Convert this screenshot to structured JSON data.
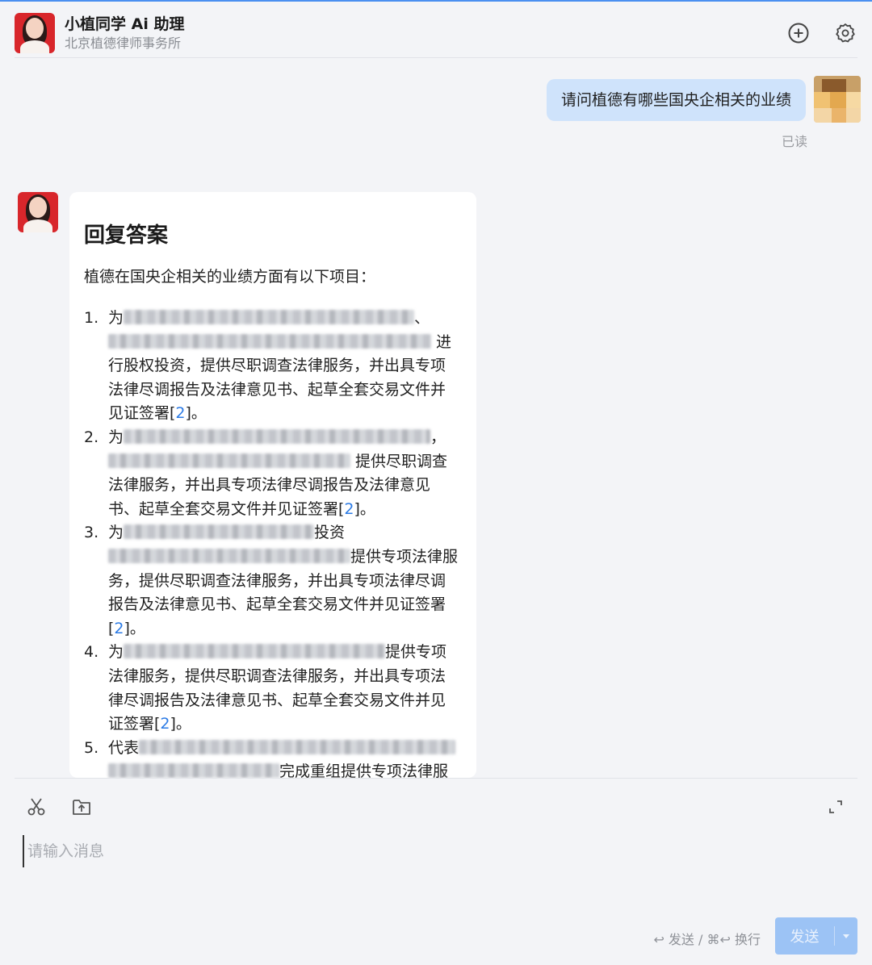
{
  "header": {
    "title": "小植同学 Ai 助理",
    "subtitle": "北京植德律师事务所",
    "avatar_icon": "assistant-avatar",
    "new_chat_icon": "plus-circle-icon",
    "settings_icon": "gear-icon"
  },
  "conversation": {
    "user_message": "请问植德有哪些国央企相关的业绩",
    "read_status": "已读",
    "answer": {
      "title": "回复答案",
      "intro": "植德在国央企相关的业绩方面有以下项目：",
      "items": [
        {
          "num": "1.",
          "pre": "为",
          "mid1": "、",
          "mid2": "进行股权投资，提供尽职调查法律服务，并出具专项法律尽调报告及法律意见书、起草全套交易文件并见证签署[",
          "cite": "2",
          "end": "]。"
        },
        {
          "num": "2.",
          "pre": "为",
          "mid1": "，",
          "mid2": "提供尽职调查法律服务，并出具专项法律尽调报告及法律意见书、起草全套交易文件并见证签署[",
          "cite": "2",
          "end": "]。"
        },
        {
          "num": "3.",
          "pre": "为",
          "mid1": "投资",
          "mid2": "提供专项法律服务，提供尽职调查法律服务，并出具专项法律尽调报告及法律意见书、起草全套交易文件并见证签署[",
          "cite": "2",
          "end": "]。"
        },
        {
          "num": "4.",
          "pre": "为",
          "mid1": "",
          "mid2": "提供专项法律服务，提供尽职调查法律服务，并出具专项法律尽调报告及法律意见书、起草全套交易文件并见证签署[",
          "cite": "2",
          "end": "]。"
        },
        {
          "num": "5.",
          "pre": "代表",
          "mid1": "",
          "mid2": "完成重组提供专项法律服务，提供尽职调查法律服务，并出具专项法律尽调",
          "cite": "",
          "end": ""
        }
      ]
    }
  },
  "composer": {
    "placeholder": "请输入消息",
    "hint": "↩ 发送 / ⌘↩ 换行",
    "send_label": "发送",
    "cut_icon": "scissors-icon",
    "upload_icon": "upload-folder-icon",
    "expand_icon": "expand-icon"
  }
}
